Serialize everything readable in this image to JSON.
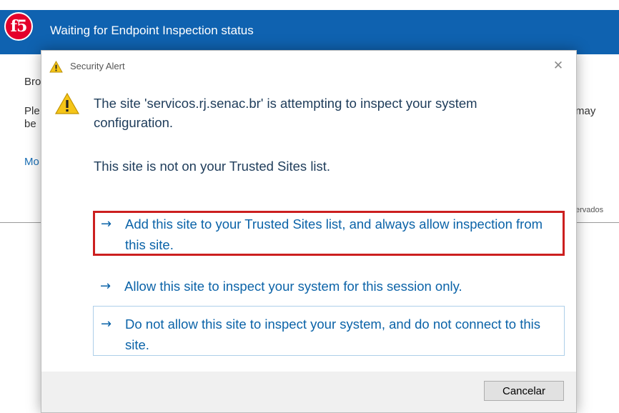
{
  "background_window": {
    "title": "Waiting for Endpoint Inspection status",
    "logo_text": "f5",
    "line_1": "Bro",
    "line_2": "Ple",
    "line_3": "be",
    "more_link": "Mo",
    "right_1": "may",
    "right_2": "ervados",
    "colors": {
      "titlebar": "#0f62b0",
      "logo": "#e4002b"
    }
  },
  "dialog": {
    "title": "Security Alert",
    "close_glyph": "✕",
    "icon": "warning-icon",
    "message": "The site 'servicos.rj.senac.br' is attempting to inspect your system configuration.",
    "trusted_notice": "This site is not on your Trusted Sites list.",
    "options": [
      {
        "arrow": "→",
        "label": "Add this site to your Trusted Sites list, and always allow inspection from this site.",
        "highlighted": true
      },
      {
        "arrow": "→",
        "label": "Allow this site to inspect your system for this session only."
      },
      {
        "arrow": "→",
        "label": "Do not allow this site to inspect your system, and do not connect to this site."
      }
    ],
    "cancel_label": "Cancelar",
    "colors": {
      "link": "#0b63a8",
      "highlight_border": "#cc1f1f",
      "text": "#1e3c5a"
    }
  }
}
